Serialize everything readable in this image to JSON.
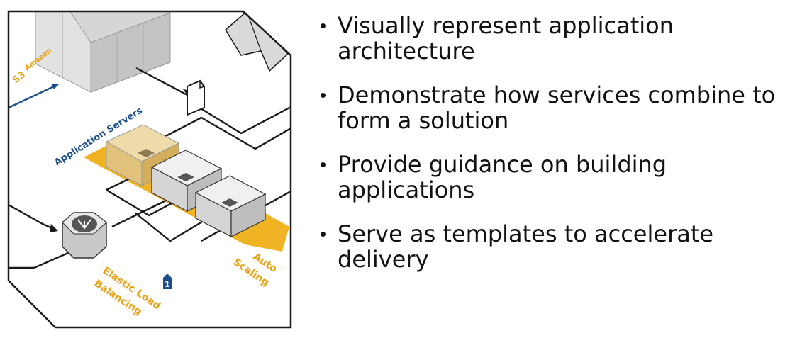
{
  "diagram": {
    "labels": {
      "amazon": "Amazon",
      "s3": "S3",
      "application_servers": "Application Servers",
      "auto_scaling_line1": "Auto",
      "auto_scaling_line2": "Scaling",
      "elb_line1": "Elastic Load",
      "elb_line2": "Balancing",
      "az_badge": "1"
    },
    "colors": {
      "orange": "#f0b323",
      "orange_text": "#e8a317",
      "blue": "#1b4f8c",
      "box_gray": "#d9d9d9",
      "outline": "#1a1a1a"
    }
  },
  "bullets": [
    "Visually represent application architecture",
    "Demonstrate how services combine to form a solution",
    "Provide guidance on building applications",
    "Serve as templates to accelerate delivery"
  ]
}
